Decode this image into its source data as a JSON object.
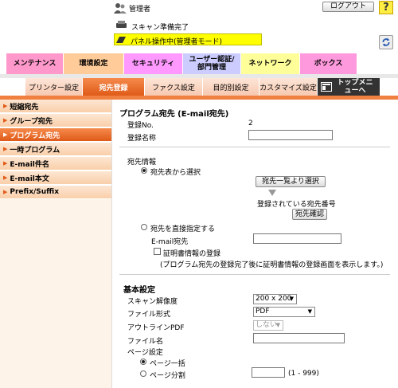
{
  "header": {
    "user_label": "管理者",
    "logout_label": "ログアウト",
    "help_label": "?",
    "status_text": "スキャン準備完了",
    "panel_text": "パネル操作中(管理者モード)"
  },
  "main_tabs": [
    {
      "label": "メンテナンス",
      "color": "#ff99cc"
    },
    {
      "label": "環境設定",
      "color": "#ffcc99"
    },
    {
      "label": "セキュリティ",
      "color": "#ff99ff"
    },
    {
      "label": "ユーザー認証/部門管理",
      "color": "#ccccff"
    },
    {
      "label": "ネットワーク",
      "color": "#ffff99"
    },
    {
      "label": "ボックス",
      "color": "#ff99dd"
    }
  ],
  "sub_tabs": [
    {
      "label": "プリンター設定"
    },
    {
      "label": "宛先登録"
    },
    {
      "label": "ファクス設定"
    },
    {
      "label": "目的別設定"
    },
    {
      "label": "カスタマイズ設定"
    },
    {
      "label": "トップメニューへ"
    }
  ],
  "sidebar": [
    {
      "label": "短縮宛先"
    },
    {
      "label": "グループ宛先"
    },
    {
      "label": "プログラム宛先"
    },
    {
      "label": "一時プログラム"
    },
    {
      "label": "E-mail件名"
    },
    {
      "label": "E-mail本文"
    },
    {
      "label": "Prefix/Suffix"
    }
  ],
  "content": {
    "title": "プログラム宛先 (E-mail宛先)",
    "reg_no_label": "登録No.",
    "reg_no_value": "2",
    "reg_name_label": "登録名称",
    "dest_info_label": "宛先情報",
    "select_from_list_label": "宛先表から選択",
    "select_from_list_btn": "宛先一覧より選択",
    "registered_no_label": "登録されている宛先番号",
    "confirm_btn": "宛先確認",
    "direct_input_label": "宛先を直接指定する",
    "email_label": "E-mail宛先",
    "cert_label": "証明書情報の登録",
    "cert_note": "(プログラム宛先の登録完了後に証明書情報の登録画面を表示します。)",
    "basic_settings_label": "基本設定",
    "scan_res_label": "スキャン解像度",
    "scan_res_value": "200 x 200",
    "file_format_label": "ファイル形式",
    "file_format_value": "PDF",
    "outline_label": "アウトラインPDF",
    "outline_value": "しない",
    "file_name_label": "ファイル名",
    "page_setting_label": "ページ設定",
    "page_all_label": "ページ一括",
    "page_split_label": "ページ分割",
    "page_split_range": "(1 - 999)"
  }
}
